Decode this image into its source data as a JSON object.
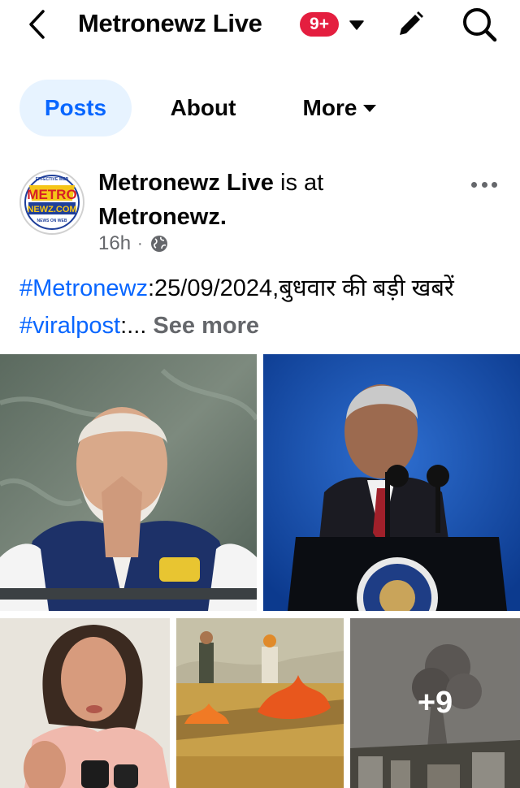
{
  "header": {
    "title": "Metronewz Live",
    "badge": "9+",
    "icons": [
      "back-chevron-icon",
      "caret-down-icon",
      "pencil-icon",
      "search-icon"
    ]
  },
  "tabs": [
    {
      "label": "Posts",
      "active": true
    },
    {
      "label": "About",
      "active": false
    },
    {
      "label": "More",
      "active": false
    }
  ],
  "post": {
    "author": "Metronewz Live",
    "checkin_text": "is at",
    "location": "Metronewz.",
    "time": "16h",
    "privacy_icon": "globe-icon",
    "text": {
      "hashtag1": "#Metronewz",
      "body1": ":25/09/2024,बुधवार की  बड़ी खबरें  ",
      "hashtag2": "#viralpost",
      "body2": ":... ",
      "see_more": "See more"
    },
    "avatar_logo": {
      "top": "METRO",
      "bottom": "NEWZ.COM",
      "arc_top": "EFFECTIVE WEB",
      "arc_bottom": "NEWS ON WEB"
    },
    "photos": [
      {
        "subject": "man-folded-hands-photo"
      },
      {
        "subject": "man-at-podium-photo"
      },
      {
        "subject": "woman-speaking-photo"
      },
      {
        "subject": "field-burning-photo"
      },
      {
        "subject": "smoke-city-photo",
        "overlay": "+9"
      }
    ]
  },
  "colors": {
    "accent": "#0866ff",
    "active_tab_bg": "#e7f3ff",
    "badge": "#e41e3f",
    "secondary_text": "#65676b"
  }
}
